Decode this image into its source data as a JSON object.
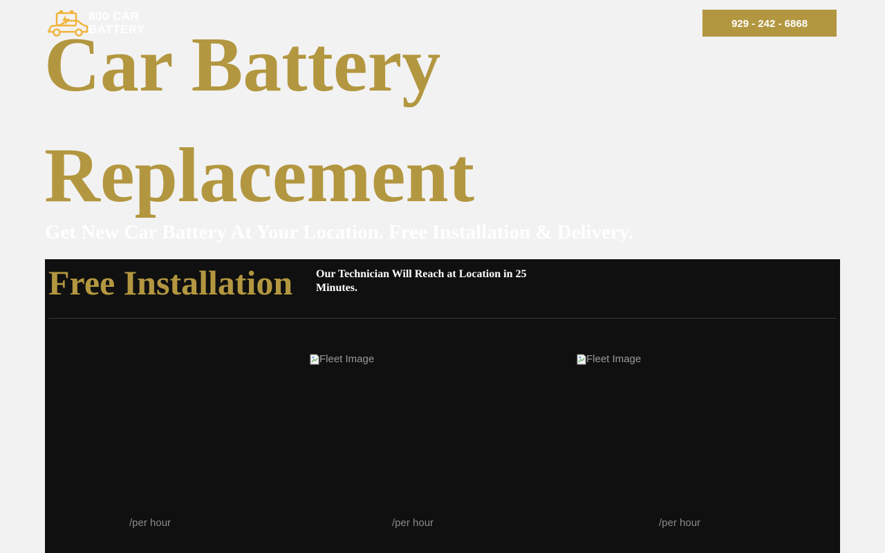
{
  "header": {
    "logo_text": "800 CAR BATTERY",
    "phone": "929 - 242 - 6868"
  },
  "hero": {
    "title": "Car Battery Replacement",
    "subtitle": "Get New Car Battery At Your Location. Free Installation & Delivery."
  },
  "section": {
    "title": "Free Installation",
    "text": "Our Technician Will Reach at Location in 25 Minutes.",
    "fleet_items": [
      {
        "image_alt": "",
        "price_label": "/per hour"
      },
      {
        "image_alt": "Fleet Image",
        "price_label": "/per hour"
      },
      {
        "image_alt": "Fleet Image",
        "price_label": "/per hour"
      }
    ]
  },
  "colors": {
    "accent": "#b39740",
    "page_background": "#f2f2f2",
    "dark_background": "#101010"
  },
  "icons": {
    "logo": "car-battery-logo-icon",
    "broken_image": "broken-image-icon"
  }
}
